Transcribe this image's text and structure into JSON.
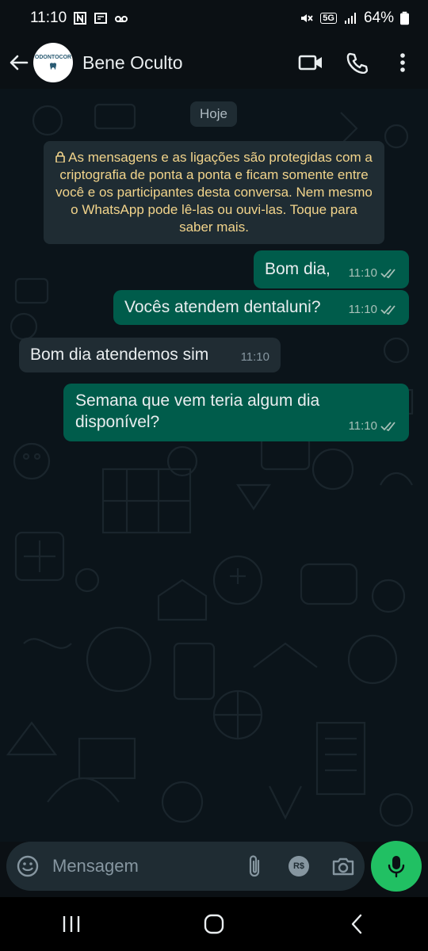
{
  "status_bar": {
    "time": "11:10",
    "network": "5G",
    "battery": "64%",
    "icons": [
      "n-icon",
      "news-icon",
      "voicemail-icon",
      "mute-icon",
      "signal-icon",
      "battery-icon"
    ]
  },
  "header": {
    "avatar_text": "ODONTOCOR",
    "contact_name": "Bene Oculto",
    "icons": [
      "back-arrow-icon",
      "video-call-icon",
      "phone-icon",
      "more-icon"
    ]
  },
  "chat": {
    "date_label": "Hoje",
    "encryption_notice": "As mensagens e as ligações são protegidas com a criptografia de ponta a ponta e ficam somente entre você e os participantes desta conversa. Nem mesmo o WhatsApp pode lê-las ou ouvi-las. Toque para saber mais.",
    "messages": [
      {
        "direction": "out",
        "text": "Bom dia,",
        "time": "11:10",
        "status": "read"
      },
      {
        "direction": "out",
        "text": "Vocês atendem dentaluni?",
        "time": "11:10",
        "status": "read"
      },
      {
        "direction": "in",
        "text": "Bom dia atendemos sim",
        "time": "11:10"
      },
      {
        "direction": "out",
        "text": "Semana que vem teria algum dia disponível?",
        "time": "11:10",
        "status": "read"
      }
    ]
  },
  "composer": {
    "placeholder": "Mensagem",
    "pay_label": "R$",
    "icons": [
      "emoji-icon",
      "attach-icon",
      "payment-icon",
      "camera-icon",
      "mic-icon"
    ]
  },
  "colors": {
    "outgoing_bubble": "#005c4b",
    "incoming_bubble": "#202c33",
    "accent": "#21c063",
    "read_ticks": "#a7c0b8"
  }
}
